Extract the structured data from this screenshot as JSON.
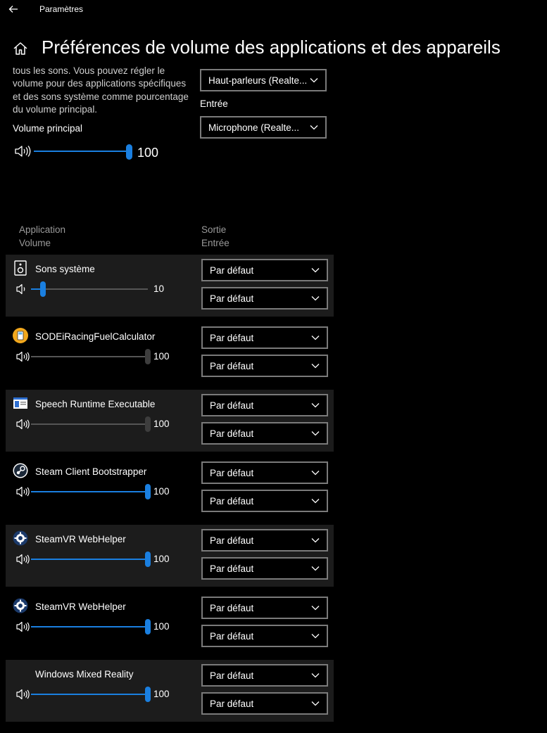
{
  "window": {
    "title": "Paramètres"
  },
  "page": {
    "title": "Préférences de volume des applications et des appareils"
  },
  "intro": {
    "description": "tous les sons. Vous pouvez régler le volume pour des applications spécifiques et des sons système comme pourcentage du volume principal.",
    "master_label": "Volume principal",
    "master_value": "100",
    "master_level": 1.0
  },
  "devices": {
    "output_value": "Haut-parleurs (Realte...",
    "input_label": "Entrée",
    "input_value": "Microphone (Realte..."
  },
  "headers": {
    "application": "Application",
    "volume": "Volume",
    "output": "Sortie",
    "input": "Entrée"
  },
  "apps": [
    {
      "name": "Sons système",
      "icon": "speaker-device-icon",
      "value": "10",
      "level": 0.1,
      "active": true,
      "output": "Par défaut",
      "input": "Par défaut"
    },
    {
      "name": "SODEiRacingFuelCalculator",
      "icon": "fuel-calculator-icon",
      "value": "100",
      "level": 1.0,
      "active": false,
      "output": "Par défaut",
      "input": "Par défaut"
    },
    {
      "name": "Speech Runtime Executable",
      "icon": "window-app-icon",
      "value": "100",
      "level": 1.0,
      "active": false,
      "output": "Par défaut",
      "input": "Par défaut"
    },
    {
      "name": "Steam Client Bootstrapper",
      "icon": "steam-icon",
      "value": "100",
      "level": 1.0,
      "active": true,
      "output": "Par défaut",
      "input": "Par défaut"
    },
    {
      "name": "SteamVR WebHelper",
      "icon": "steamvr-icon",
      "value": "100",
      "level": 1.0,
      "active": true,
      "output": "Par défaut",
      "input": "Par défaut"
    },
    {
      "name": "SteamVR WebHelper",
      "icon": "steamvr-icon",
      "value": "100",
      "level": 1.0,
      "active": true,
      "output": "Par défaut",
      "input": "Par défaut"
    },
    {
      "name": "Windows Mixed Reality",
      "icon": "",
      "value": "100",
      "level": 1.0,
      "active": true,
      "output": "Par défaut",
      "input": "Par défaut"
    }
  ],
  "colors": {
    "accent": "#1a7fe0",
    "background": "#000000",
    "row_shade": "#1c1c1c"
  }
}
